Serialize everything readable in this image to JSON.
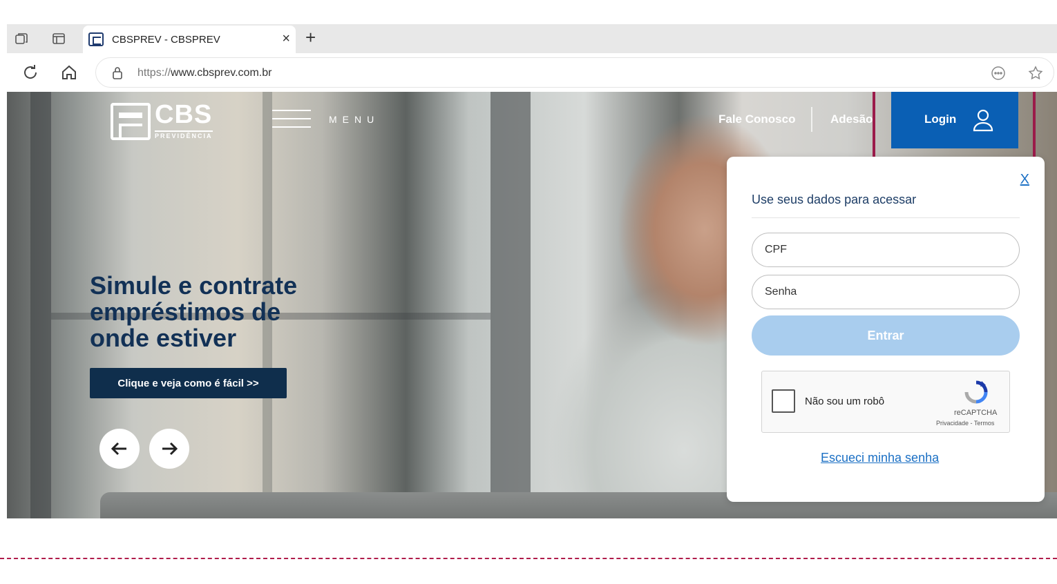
{
  "browser": {
    "tab_title": "CBSPREV - CBSPREV",
    "tab_close": "×",
    "new_tab": "+",
    "url_protocol": "https://",
    "url_host": "www.cbsprev.com.br"
  },
  "site": {
    "logo_text": "CBS",
    "logo_sub": "PREVIDÊNCIA",
    "menu_label": "MENU",
    "nav": {
      "contact": "Fale Conosco",
      "adhesion": "Adesão",
      "login": "Login"
    },
    "hero": {
      "title": "Simule e contrate empréstimos de onde estiver",
      "cta": "Clique e veja como é fácil >>"
    }
  },
  "login_panel": {
    "close": "X",
    "title": "Use seus dados para acessar",
    "cpf_placeholder": "CPF",
    "password_placeholder": "Senha",
    "submit": "Entrar",
    "recaptcha_label": "Não sou um robô",
    "recaptcha_brand": "reCAPTCHA",
    "recaptcha_terms": "Privacidade - Termos",
    "forgot": "Escueci minha senha"
  },
  "colors": {
    "brand_blue": "#0a5fb4",
    "hero_title": "#123156",
    "highlight": "#9b1b4a",
    "enter_disabled": "#a9cdee"
  }
}
